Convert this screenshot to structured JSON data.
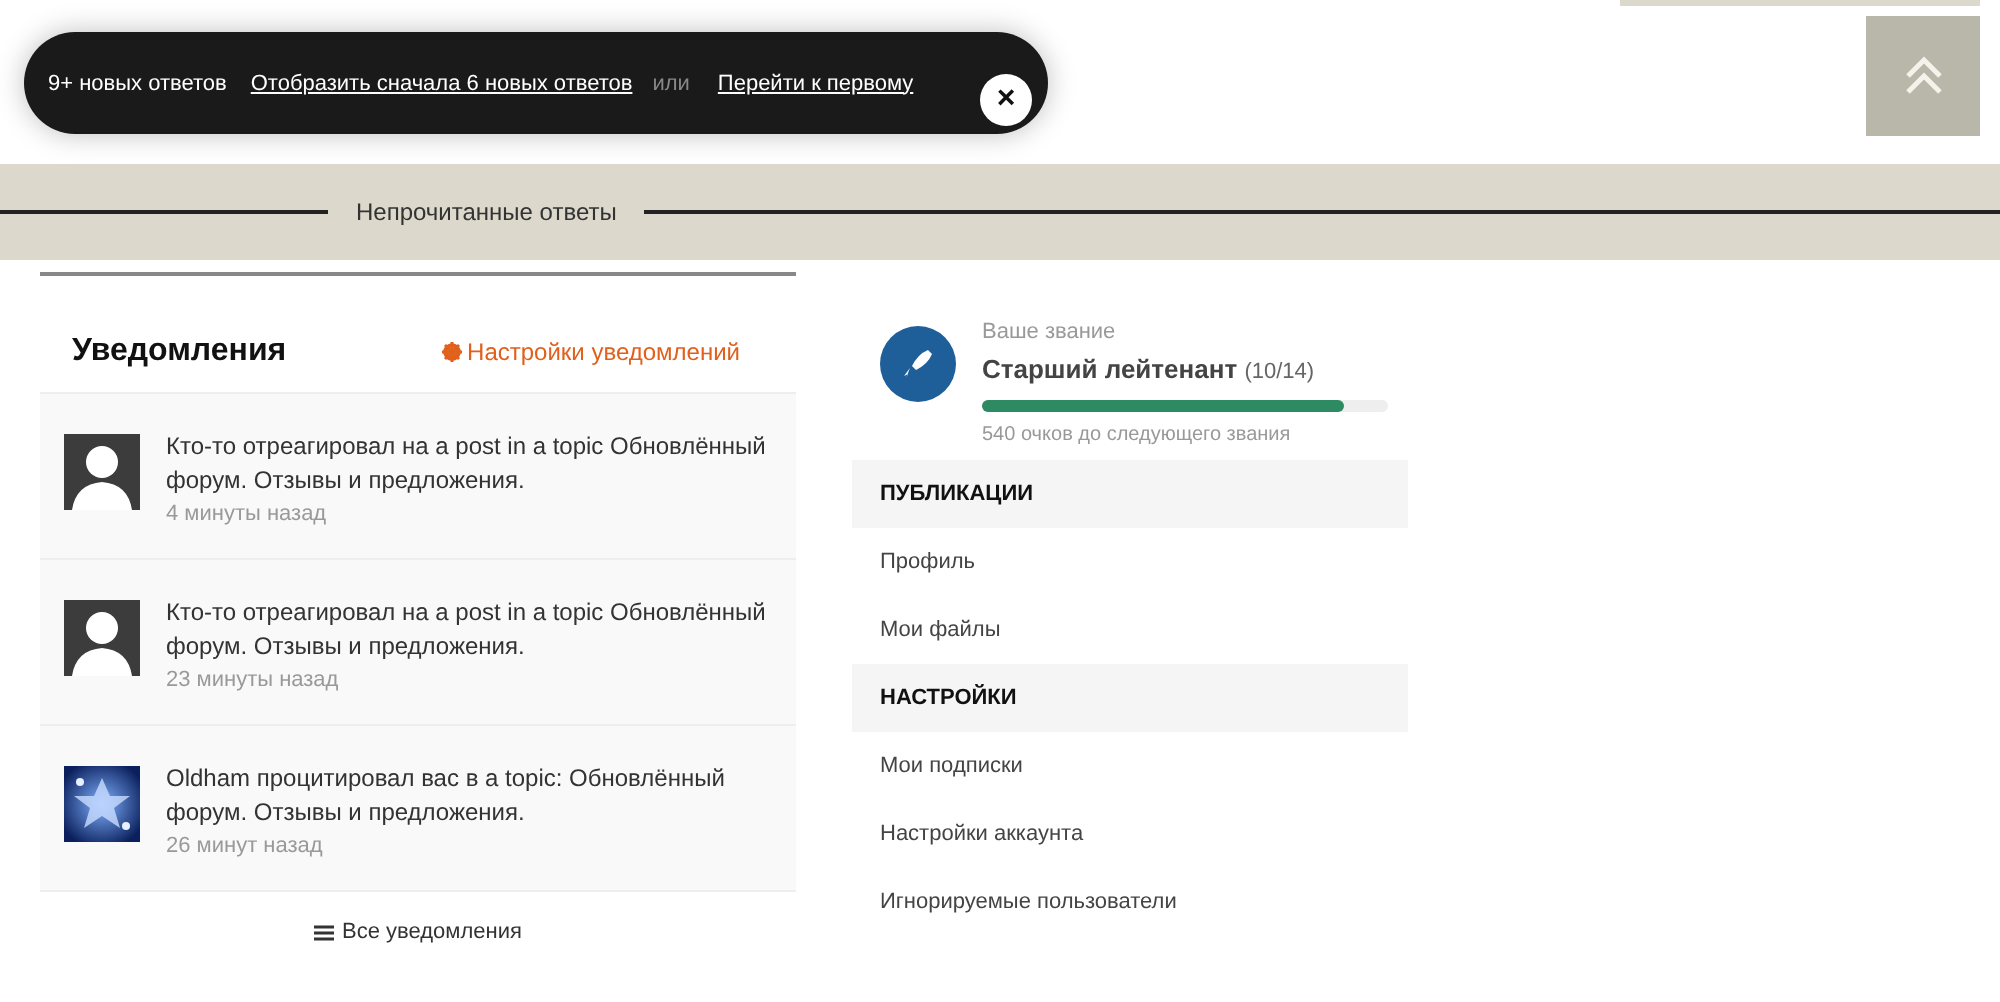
{
  "toast": {
    "count": "9+ новых ответов",
    "show_link": "Отобразить сначала 6 новых ответов",
    "separator": "или",
    "jump_link": "Перейти к первому",
    "close": "×"
  },
  "divider": {
    "label": "Непрочитанные ответы"
  },
  "notifications": {
    "title": "Уведомления",
    "settings_link": "Настройки уведомлений",
    "items": [
      {
        "kind": "silhouette",
        "text": "Кто-то отреагировал на a post in a topic Обновлённый форум. Отзывы и предложения.",
        "time": "4 минуты назад"
      },
      {
        "kind": "silhouette",
        "text": "Кто-то отреагировал на a post in a topic Обновлённый форум. Отзывы и предложения.",
        "time": "23 минуты назад"
      },
      {
        "kind": "picture",
        "text": "Oldham процитировал вас в a topic: Обновлённый форум. Отзывы и предложения.",
        "time": "26 минут назад"
      }
    ],
    "all_link": "Все уведомления"
  },
  "rank": {
    "caption": "Ваше звание",
    "name": "Старший лейтенант",
    "count": "(10/14)",
    "level": 0.89,
    "points": "540 очков до следующего звания"
  },
  "menu": [
    {
      "kind": "header",
      "label": "ПУБЛИКАЦИИ"
    },
    {
      "kind": "item",
      "label": "Профиль"
    },
    {
      "kind": "item",
      "label": "Мои файлы"
    },
    {
      "kind": "header",
      "label": "НАСТРОЙКИ"
    },
    {
      "kind": "item",
      "label": "Мои подписки"
    },
    {
      "kind": "item",
      "label": "Настройки аккаунта"
    },
    {
      "kind": "item",
      "label": "Игнорируемые пользователи"
    }
  ]
}
